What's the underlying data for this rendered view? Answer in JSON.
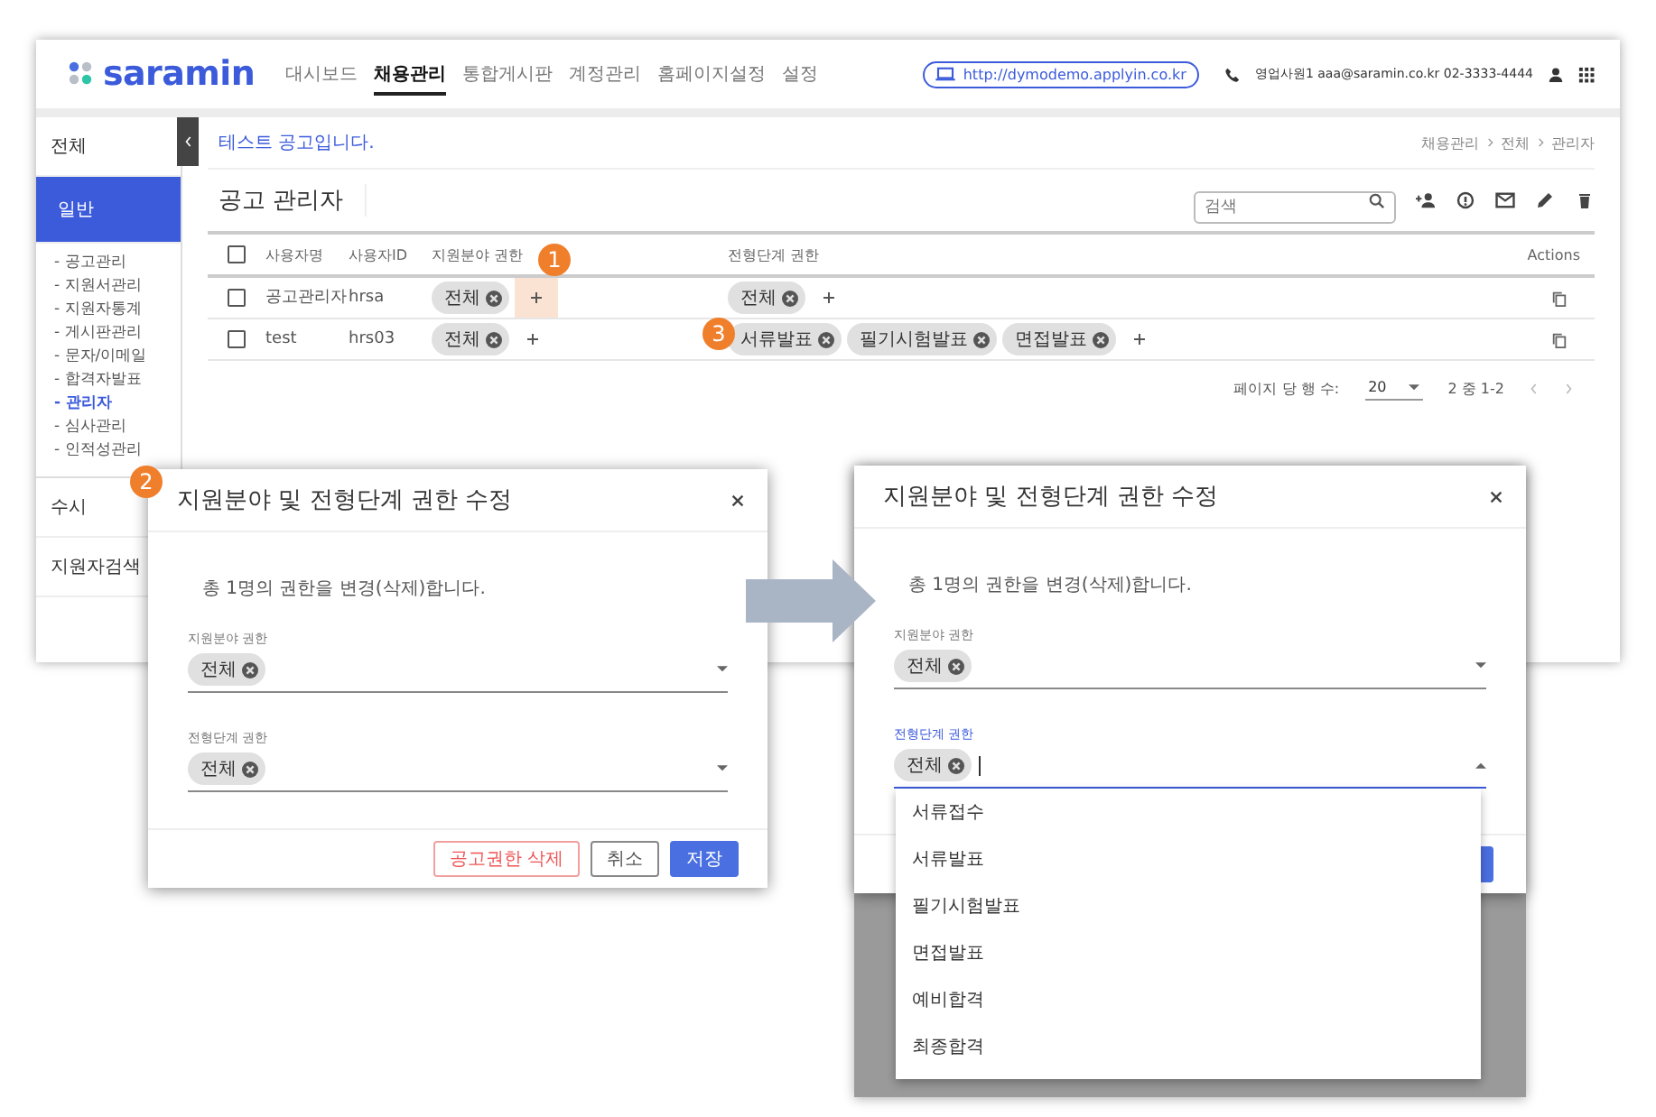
{
  "header": {
    "logo": "saramin",
    "nav": [
      {
        "label": "대시보드",
        "selected": false
      },
      {
        "label": "채용관리",
        "selected": true
      },
      {
        "label": "통합게시판",
        "selected": false
      },
      {
        "label": "계정관리",
        "selected": false
      },
      {
        "label": "홈페이지설정",
        "selected": false
      },
      {
        "label": "설정",
        "selected": false
      }
    ],
    "site_url": "http://dymodemo.applyin.co.kr",
    "contact": "영업사원1 aaa@saramin.co.kr 02-3333-4444"
  },
  "sidebar": {
    "items": [
      {
        "label": "전체",
        "selected": false
      },
      {
        "label": "일반",
        "selected": true,
        "children": [
          {
            "label": "- 공고관리",
            "selected": false
          },
          {
            "label": "- 지원서관리",
            "selected": false
          },
          {
            "label": "- 지원자통계",
            "selected": false
          },
          {
            "label": "- 게시판관리",
            "selected": false
          },
          {
            "label": "- 문자/이메일",
            "selected": false
          },
          {
            "label": "- 합격자발표",
            "selected": false
          },
          {
            "label": "- 관리자",
            "selected": true
          },
          {
            "label": "- 심사관리",
            "selected": false
          },
          {
            "label": "- 인적성관리",
            "selected": false
          }
        ]
      },
      {
        "label": "수시",
        "selected": false
      },
      {
        "label": "지원자검색",
        "selected": false
      }
    ]
  },
  "notice": "테스트 공고입니다.",
  "breadcrumb": [
    "채용관리",
    "전체",
    "관리자"
  ],
  "panel": {
    "title": "공고 관리자",
    "search": {
      "placeholder": "검색"
    }
  },
  "table": {
    "header_checked": false,
    "columns": [
      "사용자명",
      "사용자ID",
      "지원분야 권한",
      "전형단계 권한",
      "Actions"
    ],
    "rows": [
      {
        "checked": false,
        "name": "공고관리자",
        "user_id": "hrsa",
        "fields": [
          "전체"
        ],
        "stages": [
          "전체"
        ],
        "add_highlighted": true
      },
      {
        "checked": false,
        "name": "test",
        "user_id": "hrs03",
        "fields": [
          "전체"
        ],
        "stages": [
          "서류발표",
          "필기시험발표",
          "면접발표"
        ],
        "add_highlighted": false
      }
    ]
  },
  "pagination": {
    "rows_label": "페이지 당 행 수:",
    "rows_per_page": "20",
    "range": "2 중 1-2"
  },
  "callouts": [
    "1",
    "2",
    "3"
  ],
  "dialogs": [
    {
      "title": "지원분야 및 전형단계 권한 수정",
      "message": "총 1명의 권한을 변경(삭제)합니다.",
      "fields": [
        {
          "label": "지원분야 권한",
          "chips": [
            "전체"
          ],
          "focused": false
        },
        {
          "label": "전형단계 권한",
          "chips": [
            "전체"
          ],
          "focused": false
        }
      ],
      "buttons": [
        {
          "label": "공고권한 삭제",
          "kind": "danger"
        },
        {
          "label": "취소",
          "kind": "outline"
        },
        {
          "label": "저장",
          "kind": "primary"
        }
      ]
    },
    {
      "title": "지원분야 및 전형단계 권한 수정",
      "message": "총 1명의 권한을 변경(삭제)합니다.",
      "fields": [
        {
          "label": "지원분야 권한",
          "chips": [
            "전체"
          ],
          "focused": false
        },
        {
          "label": "전형단계 권한",
          "chips": [
            "전체"
          ],
          "focused": true
        }
      ],
      "options": [
        "서류접수",
        "서류발표",
        "필기시험발표",
        "면접발표",
        "예비합격",
        "최종합격"
      ]
    }
  ]
}
